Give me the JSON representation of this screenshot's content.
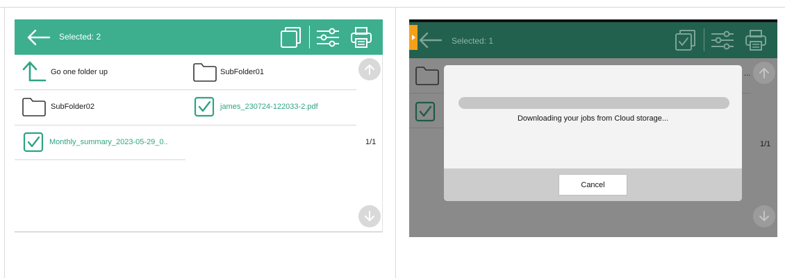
{
  "left_screen": {
    "header": {
      "title": "Selected: 2",
      "icons": [
        "back-arrow-icon",
        "copy-icon",
        "filter-sliders-icon",
        "print-icon"
      ]
    },
    "items": [
      {
        "label": "Go one folder up",
        "icon": "folder-up-arrow-icon",
        "selected": false
      },
      {
        "label": "SubFolder01",
        "icon": "folder-icon",
        "selected": false
      },
      {
        "label": "SubFolder02",
        "icon": "folder-icon",
        "selected": false
      },
      {
        "label": "james_230724-122033-2.pdf",
        "icon": "checkbox-checked-icon",
        "selected": true
      },
      {
        "label": "Monthly_summary_2023-05-29_0..",
        "icon": "checkbox-checked-icon",
        "selected": true
      }
    ],
    "page_indicator": "1/1"
  },
  "right_screen": {
    "header": {
      "title": "Selected: 1",
      "icons": [
        "back-arrow-icon",
        "check-copy-icon",
        "filter-sliders-icon",
        "print-icon"
      ]
    },
    "background_page_indicator": "1/1",
    "background_partial_text": "...",
    "dialog": {
      "message": "Downloading your jobs from Cloud storage...",
      "cancel_label": "Cancel"
    }
  },
  "colors": {
    "header_green": "#3daf8e",
    "header_green_dimmed": "#23614f",
    "selected_text": "#2fa382",
    "accent_orange": "#f6a019"
  }
}
